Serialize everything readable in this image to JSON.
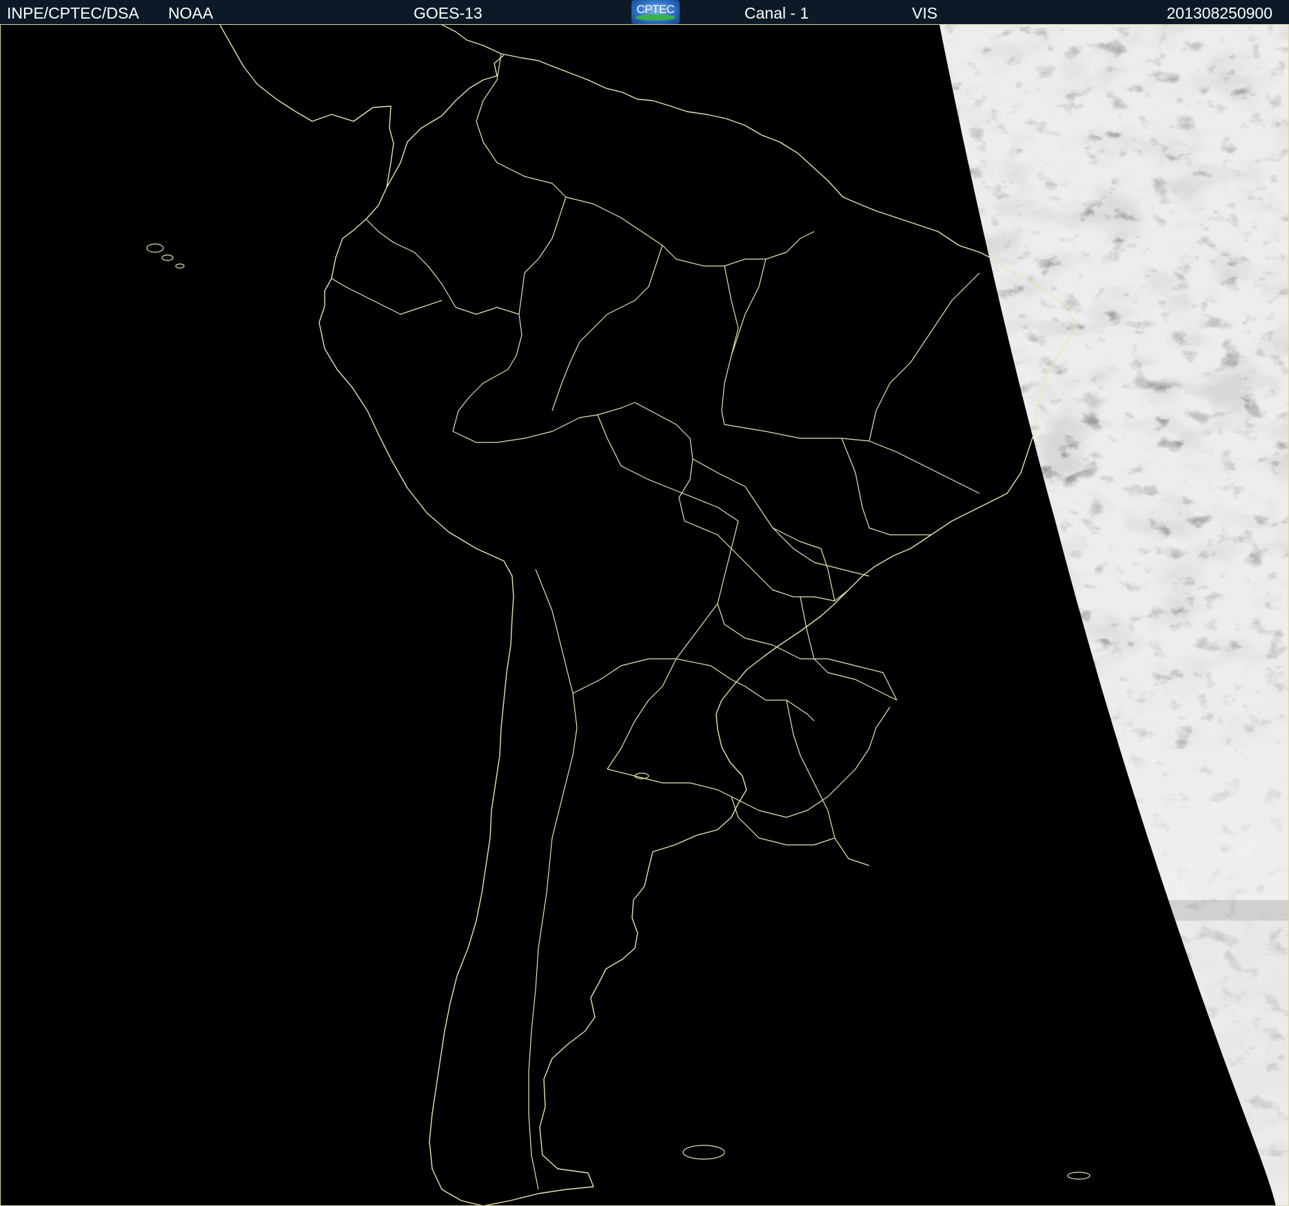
{
  "header": {
    "organization": "INPE/CPTEC/DSA",
    "agency": "NOAA",
    "satellite": "GOES-13",
    "logo_text": "CPTEC",
    "channel": "Canal - 1",
    "band": "VIS",
    "timestamp": "201308250900"
  },
  "colors": {
    "header_background": "#0c1a27",
    "header_text": "#ffffff",
    "map_background": "#000000",
    "boundary_lines": "#e8e6b0",
    "cloud_light": "#e6e6e6",
    "cloud_dark": "#6a6a6a"
  },
  "map": {
    "region": "South America",
    "image_type": "visible satellite imagery",
    "night_side": "west",
    "day_side": "east"
  }
}
